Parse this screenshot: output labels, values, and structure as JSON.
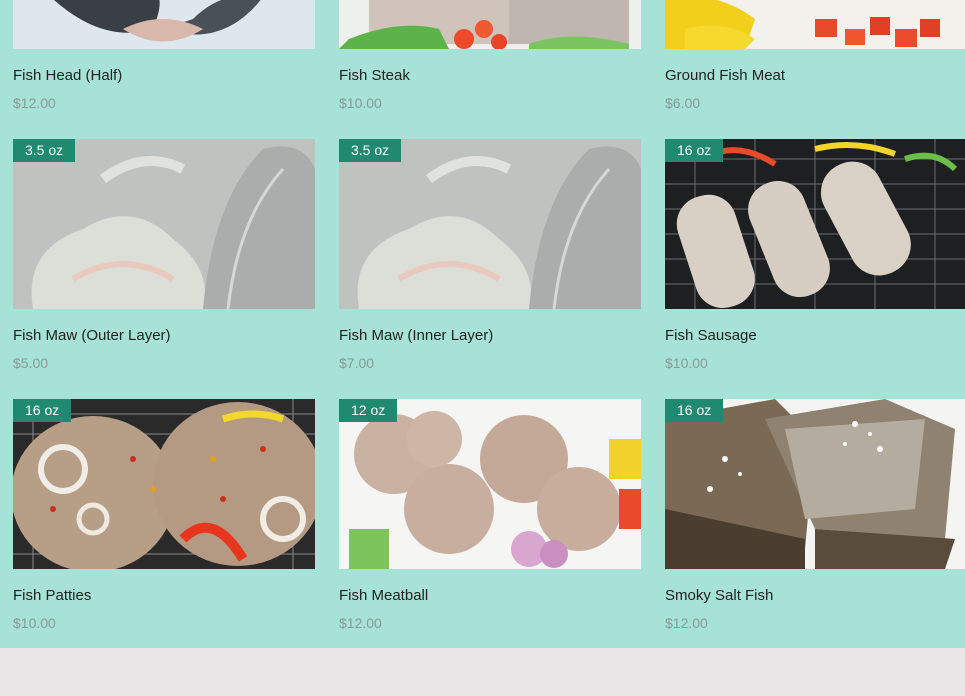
{
  "products": [
    {
      "name": "Fish Head (Half)",
      "price": "$12.00",
      "badge": ""
    },
    {
      "name": "Fish Steak",
      "price": "$10.00",
      "badge": ""
    },
    {
      "name": "Ground Fish Meat",
      "price": "$6.00",
      "badge": ""
    },
    {
      "name": "Fish Maw (Outer Layer)",
      "price": "$5.00",
      "badge": "3.5 oz"
    },
    {
      "name": "Fish Maw (Inner Layer)",
      "price": "$7.00",
      "badge": "3.5 oz"
    },
    {
      "name": "Fish Sausage",
      "price": "$10.00",
      "badge": "16 oz"
    },
    {
      "name": "Fish Patties",
      "price": "$10.00",
      "badge": "16 oz"
    },
    {
      "name": "Fish Meatball",
      "price": "$12.00",
      "badge": "12 oz"
    },
    {
      "name": "Smoky Salt Fish",
      "price": "$12.00",
      "badge": "16 oz"
    }
  ],
  "colors": {
    "section_bg": "#a6e2d6",
    "ribbon": "#1f8a6f",
    "page_bg": "#e8e6e6",
    "price": "#8a9a96"
  }
}
